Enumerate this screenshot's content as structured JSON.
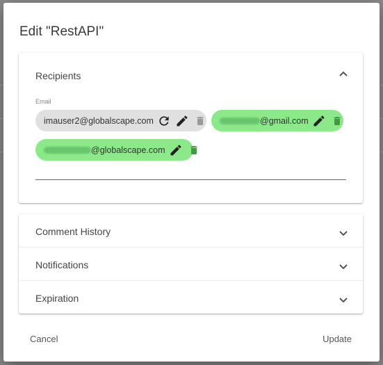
{
  "dialog": {
    "title": "Edit \"RestAPI\"",
    "recipients": {
      "header": "Recipients",
      "field_label": "Email",
      "chips": [
        {
          "text": "imauser2@globalscape.com",
          "status": "default"
        },
        {
          "text": "@gmail.com",
          "status": "added",
          "obscured_prefix": true
        },
        {
          "text": "@globalscape.com",
          "status": "added",
          "obscured_prefix": true
        }
      ]
    },
    "sections": [
      {
        "label": "Comment History"
      },
      {
        "label": "Notifications"
      },
      {
        "label": "Expiration"
      }
    ],
    "buttons": {
      "cancel": "Cancel",
      "update": "Update"
    }
  },
  "colors": {
    "chip_default": "#e0e0e0",
    "chip_added": "#8ce98a",
    "overlay": "#8a8a8a"
  },
  "icons": {
    "collapse": "chevron-up-icon",
    "expand": "chevron-down-icon",
    "reset": "refresh-icon",
    "edit": "pencil-icon",
    "delete": "trash-icon"
  }
}
